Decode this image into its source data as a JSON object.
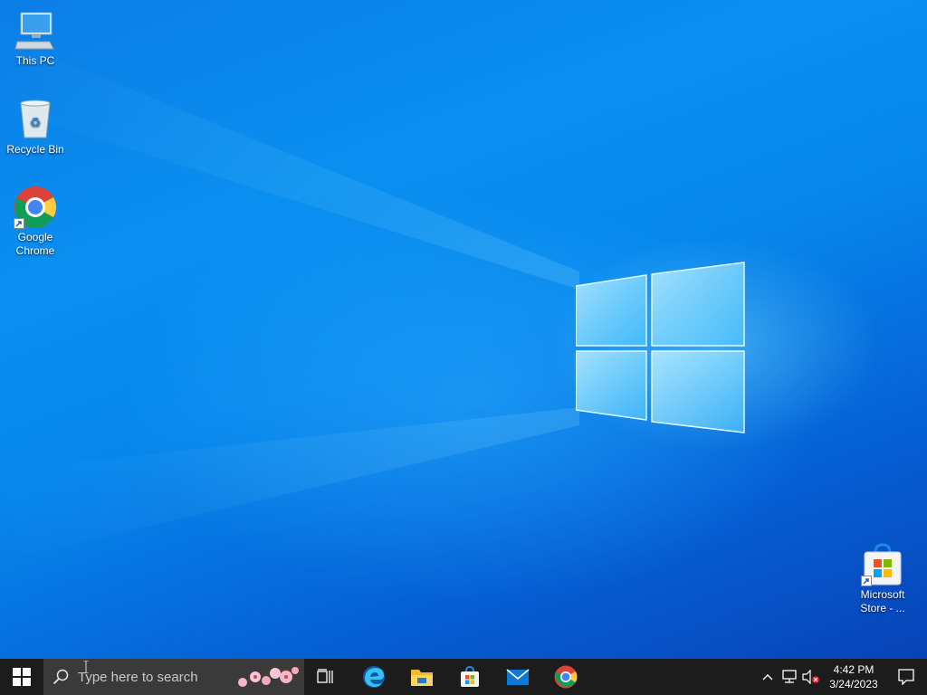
{
  "desktop": {
    "icons": [
      {
        "label": "This PC",
        "icon": "this-pc-icon"
      },
      {
        "label": "Recycle Bin",
        "icon": "recycle-bin-icon"
      },
      {
        "label": "Google Chrome",
        "icon": "chrome-icon"
      },
      {
        "label": "Microsoft Store - ...",
        "icon": "microsoft-store-icon"
      }
    ]
  },
  "taskbar": {
    "search_placeholder": "Type here to search",
    "apps": [
      "task-view-icon",
      "edge-icon",
      "file-explorer-icon",
      "store-icon",
      "mail-icon",
      "chrome-icon"
    ],
    "clock": {
      "time": "4:42 PM",
      "date": "3/24/2023"
    }
  },
  "colors": {
    "taskbar": "#1c1c1c",
    "search": "#3a3a3a",
    "wallpaper": "#0a7fe8"
  }
}
